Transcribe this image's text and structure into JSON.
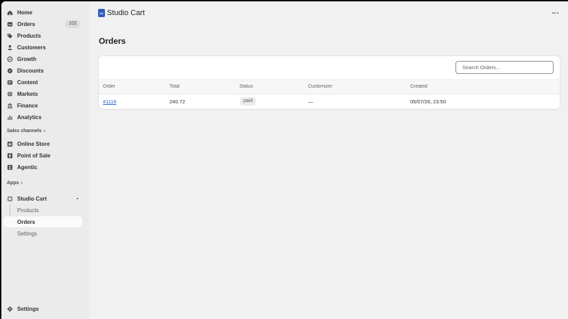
{
  "sidebar": {
    "nav": [
      {
        "label": "Home",
        "icon": "home-icon"
      },
      {
        "label": "Orders",
        "icon": "orders-icon",
        "badge": "102"
      },
      {
        "label": "Products",
        "icon": "tag-icon"
      },
      {
        "label": "Customers",
        "icon": "person-icon"
      },
      {
        "label": "Growth",
        "icon": "growth-icon"
      },
      {
        "label": "Discounts",
        "icon": "discount-icon"
      },
      {
        "label": "Content",
        "icon": "content-icon"
      },
      {
        "label": "Markets",
        "icon": "globe-icon"
      },
      {
        "label": "Finance",
        "icon": "bank-icon"
      },
      {
        "label": "Analytics",
        "icon": "bar-chart-icon"
      }
    ],
    "sales_channels_label": "Sales channels",
    "channels": [
      {
        "label": "Online Store",
        "icon": "store-icon"
      },
      {
        "label": "Point of Sale",
        "icon": "pos-icon"
      },
      {
        "label": "Agentic",
        "icon": "agentic-icon"
      }
    ],
    "apps_label": "Apps",
    "app": {
      "label": "Studio Cart",
      "icon": "app-icon"
    },
    "app_subitems": [
      {
        "label": "Products"
      },
      {
        "label": "Orders",
        "active": true
      },
      {
        "label": "Settings"
      }
    ],
    "settings_label": "Settings"
  },
  "header": {
    "app_logo_text": "SC",
    "app_title": "Studio Cart"
  },
  "page": {
    "title": "Orders",
    "search_placeholder": "Search Orders...",
    "columns": {
      "order": "Order",
      "total": "Total",
      "status": "Status",
      "customizer": "Customizer",
      "created": "Created"
    },
    "rows": [
      {
        "order": "#1116",
        "total": "240.72",
        "status": "paid",
        "customizer": "—",
        "created": "05/07/26, 23:50"
      }
    ]
  },
  "colors": {
    "accent": "#2d5ac4",
    "link": "#2a63c9",
    "sidebar_bg": "#ebebeb",
    "page_bg": "#f1f1f1"
  }
}
